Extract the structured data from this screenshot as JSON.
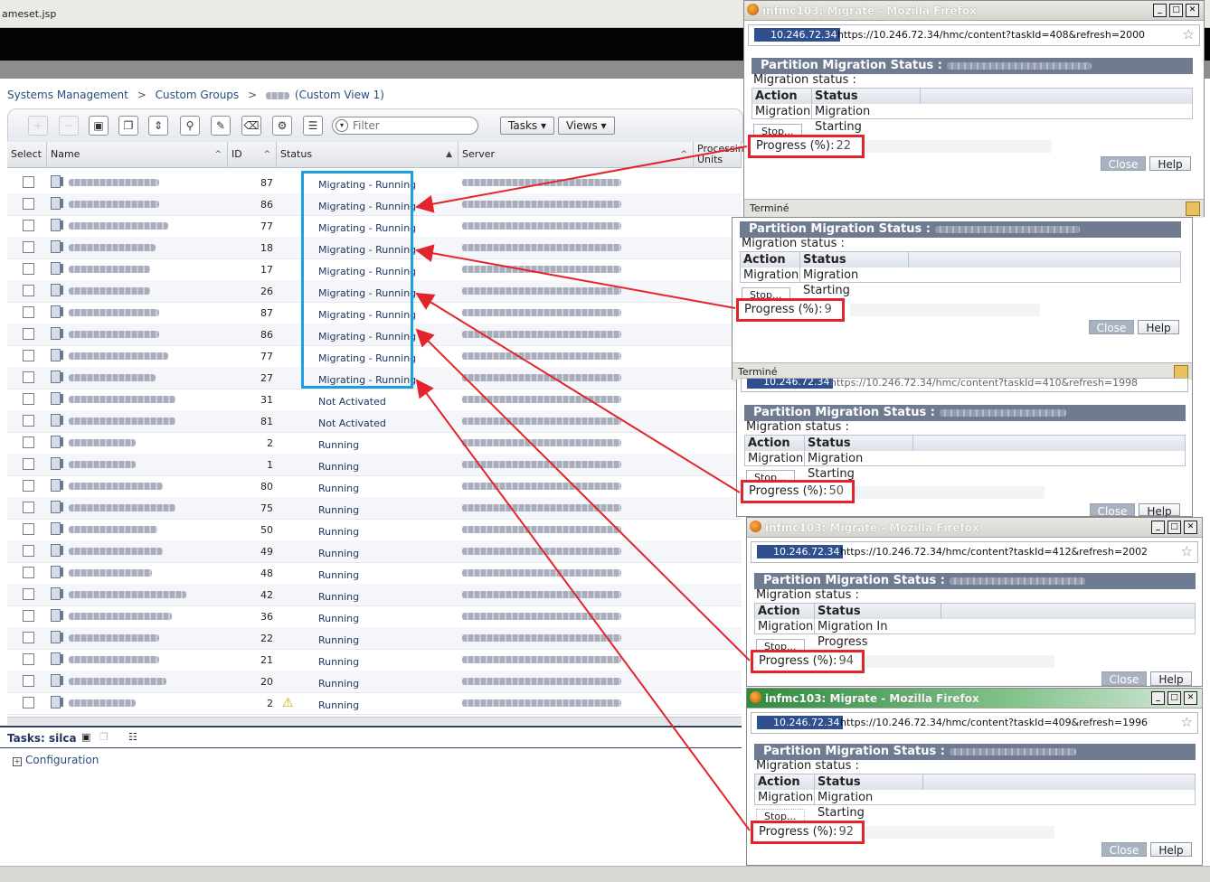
{
  "window": {
    "title": "ameset.jsp"
  },
  "breadcrumb": {
    "item1": "Systems Management",
    "sep": ">",
    "item2": "Custom Groups",
    "item3": "(Custom View 1)"
  },
  "toolbar": {
    "filter_placeholder": "Filter",
    "tasks_label": "Tasks",
    "views_label": "Views"
  },
  "columns": {
    "select": "Select",
    "name": "Name",
    "id": "ID",
    "status": "Status",
    "server": "Server",
    "processing": "Processin",
    "processing2": "Units"
  },
  "rows": [
    {
      "id": "87",
      "status": "Migrating - Running"
    },
    {
      "id": "86",
      "status": "Migrating - Running"
    },
    {
      "id": "77",
      "status": "Migrating - Running"
    },
    {
      "id": "18",
      "status": "Migrating - Running"
    },
    {
      "id": "17",
      "status": "Migrating - Running"
    },
    {
      "id": "26",
      "status": "Migrating - Running"
    },
    {
      "id": "87",
      "status": "Migrating - Running"
    },
    {
      "id": "86",
      "status": "Migrating - Running"
    },
    {
      "id": "77",
      "status": "Migrating - Running"
    },
    {
      "id": "27",
      "status": "Migrating - Running"
    },
    {
      "id": "31",
      "status": "Not Activated"
    },
    {
      "id": "81",
      "status": "Not Activated"
    },
    {
      "id": "2",
      "status": "Running"
    },
    {
      "id": "1",
      "status": "Running"
    },
    {
      "id": "80",
      "status": "Running"
    },
    {
      "id": "75",
      "status": "Running"
    },
    {
      "id": "50",
      "status": "Running"
    },
    {
      "id": "49",
      "status": "Running"
    },
    {
      "id": "48",
      "status": "Running"
    },
    {
      "id": "42",
      "status": "Running"
    },
    {
      "id": "36",
      "status": "Running"
    },
    {
      "id": "22",
      "status": "Running"
    },
    {
      "id": "21",
      "status": "Running"
    },
    {
      "id": "20",
      "status": "Running"
    },
    {
      "id": "2",
      "status": "Running",
      "warning": true
    }
  ],
  "tasks_panel": {
    "title": "Tasks: silca",
    "config": "Configuration"
  },
  "popups": [
    {
      "title": "infmc103: Migrate - Mozilla Firefox",
      "ip": "10.246.72.34",
      "url": "https://10.246.72.34/hmc/content?taskId=408&refresh=2000",
      "heading": "Partition Migration Status :",
      "migration_status": "Migration status :",
      "action_h": "Action",
      "status_h": "Status",
      "action": "Migration",
      "status": "Migration Starting",
      "stop": "Stop...",
      "progress_label": "Progress (%):",
      "progress": "22",
      "close": "Close",
      "help": "Help",
      "statusbar": "Terminé"
    },
    {
      "heading": "Partition Migration Status :",
      "migration_status": "Migration status :",
      "action_h": "Action",
      "status_h": "Status",
      "action": "Migration",
      "status": "Migration Starting",
      "stop": "Stop...",
      "progress_label": "Progress (%):",
      "progress": "9",
      "close": "Close",
      "help": "Help",
      "statusbar": "Terminé",
      "url_partial": "https://10.246.72.34/hmc/content?taskId=410&refresh=1998"
    },
    {
      "heading": "Partition Migration Status :",
      "migration_status": "Migration status :",
      "action_h": "Action",
      "status_h": "Status",
      "action": "Migration",
      "status": "Migration Starting",
      "stop": "Stop...",
      "progress_label": "Progress (%):",
      "progress": "50",
      "close": "Close",
      "help": "Help"
    },
    {
      "title": "infmc103: Migrate - Mozilla Firefox",
      "ip": "10.246.72.34",
      "url": "https://10.246.72.34/hmc/content?taskId=412&refresh=2002",
      "heading": "Partition Migration Status :",
      "migration_status": "Migration status :",
      "action_h": "Action",
      "status_h": "Status",
      "action": "Migration",
      "status": "Migration In Progress",
      "stop": "Stop...",
      "progress_label": "Progress (%):",
      "progress": "94",
      "close": "Close",
      "help": "Help"
    },
    {
      "title": "infmc103: Migrate - Mozilla Firefox",
      "ip": "10.246.72.34",
      "url": "https://10.246.72.34/hmc/content?taskId=409&refresh=1996",
      "heading": "Partition Migration Status :",
      "migration_status": "Migration status :",
      "action_h": "Action",
      "status_h": "Status",
      "action": "Migration",
      "status": "Migration Starting",
      "stop": "Stop...",
      "progress_label": "Progress (%):",
      "progress": "92",
      "close": "Close",
      "help": "Help"
    }
  ],
  "colors": {
    "annotation_red": "#e3252b",
    "highlight_blue": "#1aa0e2"
  }
}
